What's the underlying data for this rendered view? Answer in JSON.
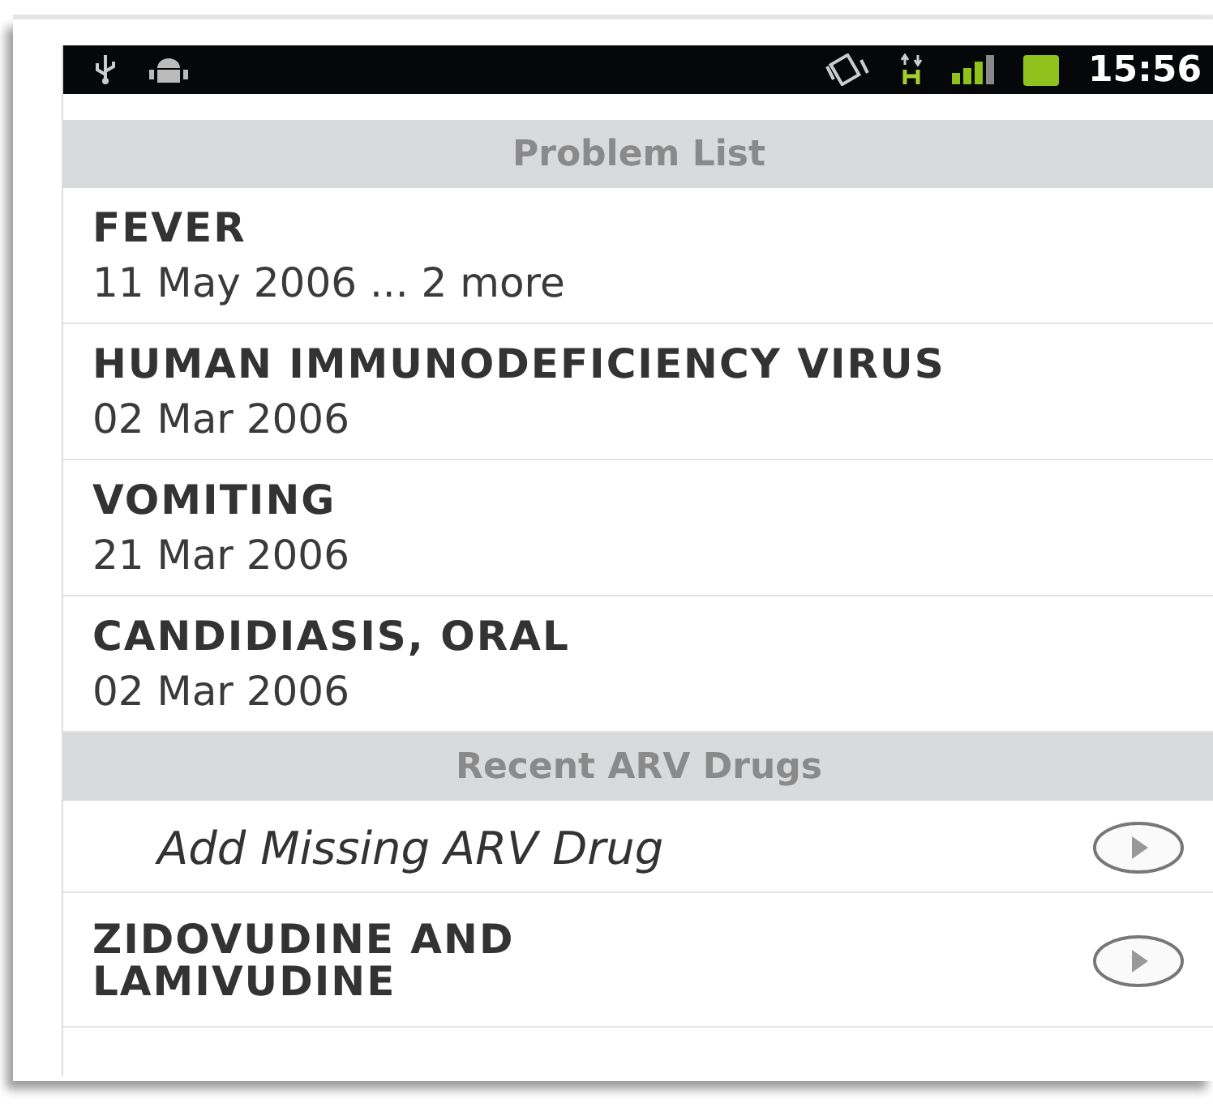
{
  "status_bar": {
    "time": "15:56"
  },
  "sections": [
    {
      "header": "Problem List",
      "items": [
        {
          "kind": "problem",
          "title": "FEVER",
          "detail": "11 May 2006 ... 2 more"
        },
        {
          "kind": "problem",
          "title": "HUMAN IMMUNODEFICIENCY VIRUS",
          "detail": "02 Mar 2006"
        },
        {
          "kind": "problem",
          "title": "VOMITING",
          "detail": "21 Mar 2006"
        },
        {
          "kind": "problem",
          "title": "CANDIDIASIS, ORAL",
          "detail": "02 Mar 2006"
        }
      ]
    },
    {
      "header": "Recent ARV Drugs",
      "items": [
        {
          "kind": "action",
          "title": "Add Missing ARV Drug"
        },
        {
          "kind": "drug",
          "title": "ZIDOVUDINE AND LAMIVUDINE"
        }
      ]
    }
  ]
}
